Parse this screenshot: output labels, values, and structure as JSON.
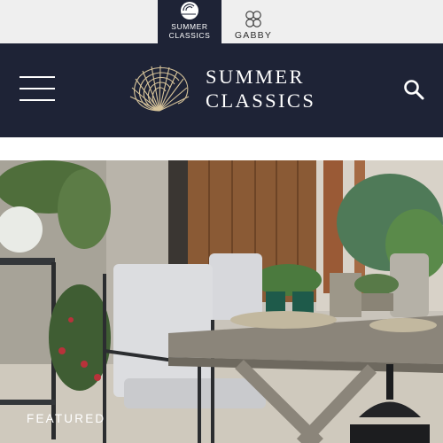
{
  "brand_switcher": {
    "active": {
      "label_line1": "SUMMER",
      "label_line2": "CLASSICS",
      "icon": "nautilus-icon"
    },
    "inactive": {
      "label": "GABBY",
      "icon": "gabby-monogram-icon"
    }
  },
  "header": {
    "menu_icon": "hamburger-menu-icon",
    "logo_line1": "SUMMER",
    "logo_line2": "CLASSICS",
    "logo_icon": "nautilus-shell-icon",
    "search_icon": "search-icon"
  },
  "hero": {
    "caption": "FEATURED",
    "image": "patio-dining-scene"
  },
  "colors": {
    "header_bg": "#1e2336",
    "brand_strip_bg": "#efefef",
    "logo_gold": "#d6c39a",
    "text_light": "#ffffff"
  }
}
